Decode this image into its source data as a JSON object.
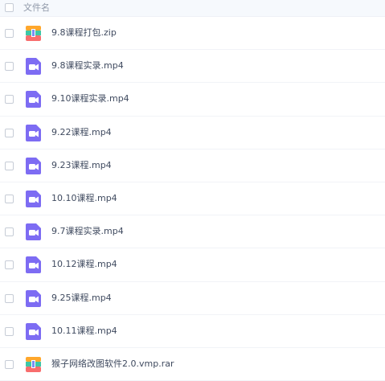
{
  "header": {
    "column_label": "文件名"
  },
  "files": [
    {
      "name": "9.8课程打包.zip",
      "icon": "archive-icon"
    },
    {
      "name": "9.8课程实录.mp4",
      "icon": "video-icon"
    },
    {
      "name": "9.10课程实录.mp4",
      "icon": "video-icon"
    },
    {
      "name": "9.22课程.mp4",
      "icon": "video-icon"
    },
    {
      "name": "9.23课程.mp4",
      "icon": "video-icon"
    },
    {
      "name": "10.10课程.mp4",
      "icon": "video-icon"
    },
    {
      "name": "9.7课程实录.mp4",
      "icon": "video-icon"
    },
    {
      "name": "10.12课程.mp4",
      "icon": "video-icon"
    },
    {
      "name": "9.25课程.mp4",
      "icon": "video-icon"
    },
    {
      "name": "10.11课程.mp4",
      "icon": "video-icon"
    },
    {
      "name": "猴子网络改图软件2.0.vmp.rar",
      "icon": "archive-icon"
    }
  ],
  "colors": {
    "video_icon": "#7d6cf3",
    "archive_top": "#ffa72c",
    "archive_middle": "#3ec7a7",
    "archive_bottom": "#f86d6d",
    "archive_accent": "#7b8cf6"
  }
}
